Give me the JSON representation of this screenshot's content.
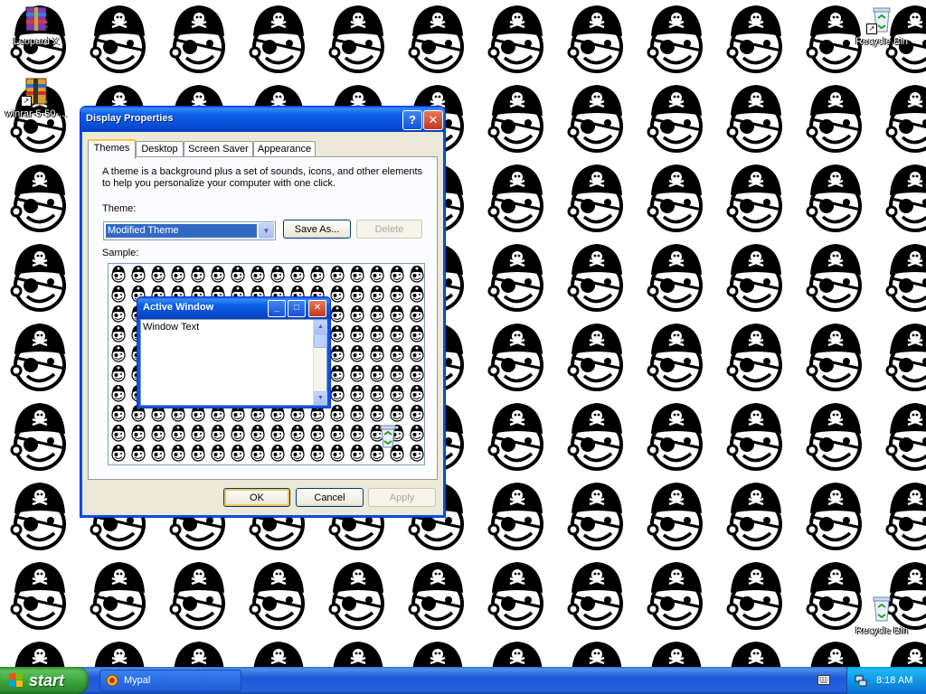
{
  "desktop": {
    "icons": [
      {
        "label": "Leopard X"
      },
      {
        "label": "winrar-5-50-..."
      },
      {
        "label": "Recycle Bin"
      },
      {
        "label": "Recycle Bin"
      }
    ]
  },
  "window": {
    "title": "Display Properties",
    "help_label": "?",
    "close_label": "✕",
    "tabs": [
      "Themes",
      "Desktop",
      "Screen Saver",
      "Appearance"
    ],
    "active_tab": "Themes",
    "description": "A theme is a background plus a set of sounds, icons, and other elements to help you personalize your computer with one click.",
    "theme_label": "Theme:",
    "theme_value": "Modified Theme",
    "save_as_label": "Save As...",
    "delete_label": "Delete",
    "sample_label": "Sample:",
    "sample": {
      "window_title": "Active Window",
      "window_text": "Window Text"
    },
    "ok_label": "OK",
    "cancel_label": "Cancel",
    "apply_label": "Apply"
  },
  "taskbar": {
    "start_label": "start",
    "task_item_label": "Mypal",
    "clock": "8:18 AM"
  },
  "colors": {
    "title_blue": "#0a56e6",
    "taskbar_blue": "#2457d6",
    "start_green": "#3c9a3c",
    "dialog_face": "#ece9d8"
  }
}
